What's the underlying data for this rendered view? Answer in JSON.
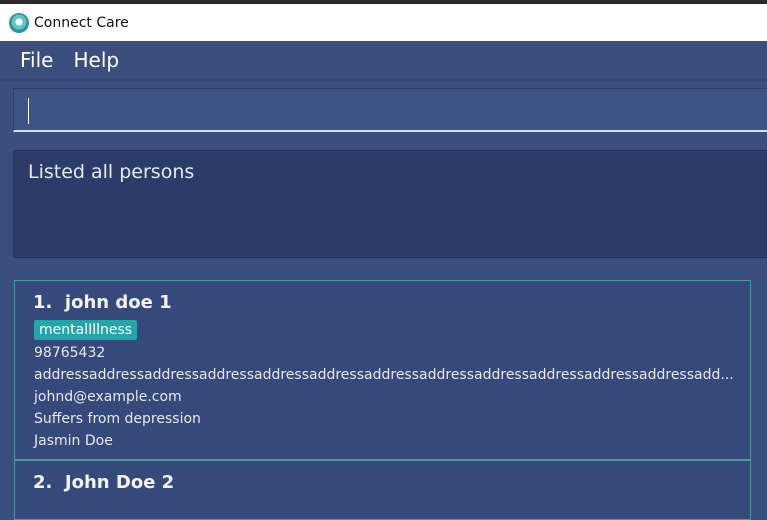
{
  "window": {
    "title": "Connect Care",
    "icon": "connect-care-logo-icon"
  },
  "menu": {
    "file_label": "File",
    "help_label": "Help"
  },
  "command": {
    "value": ""
  },
  "result": {
    "message": "Listed all persons"
  },
  "persons": [
    {
      "index": "1.",
      "name": "john doe 1",
      "tag": "mentalIllness",
      "phone": "98765432",
      "address": "addressaddressaddressaddressaddressaddressaddressaddressaddressaddressaddressaddressadd...",
      "email": "johnd@example.com",
      "condition": "Suffers from depression",
      "contact": "Jasmin Doe"
    },
    {
      "index": "2.",
      "name": "John Doe 2"
    }
  ],
  "colors": {
    "background": "#3a4f7d",
    "result_box": "#2b3c68",
    "tag": "#21a7a9",
    "card_border": "#4d9aa3"
  }
}
